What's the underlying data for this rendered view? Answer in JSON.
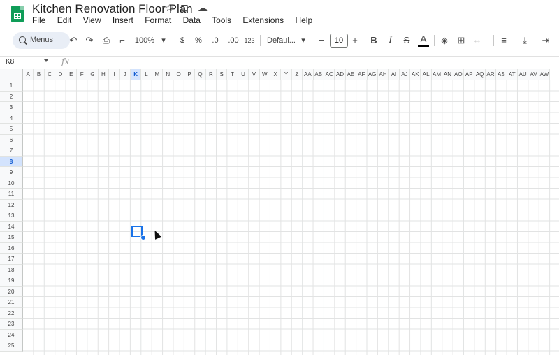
{
  "doc": {
    "title": "Kitchen Renovation Floor Plan"
  },
  "menu": [
    "File",
    "Edit",
    "View",
    "Insert",
    "Format",
    "Data",
    "Tools",
    "Extensions",
    "Help"
  ],
  "toolbar": {
    "search_label": "Menus",
    "zoom": "100%",
    "currency": "$",
    "percent": "%",
    "dec_decrease": ".0",
    "dec_increase": ".00",
    "number_format": "123",
    "font": "Defaul...",
    "font_size": "10"
  },
  "formula": {
    "cell_ref": "K8",
    "fx": "fx",
    "value": ""
  },
  "grid": {
    "columns": [
      "A",
      "B",
      "C",
      "D",
      "E",
      "F",
      "G",
      "H",
      "I",
      "J",
      "K",
      "L",
      "M",
      "N",
      "O",
      "P",
      "Q",
      "R",
      "S",
      "T",
      "U",
      "V",
      "W",
      "X",
      "Y",
      "Z",
      "AA",
      "AB",
      "AC",
      "AD",
      "AE",
      "AF",
      "AG",
      "AH",
      "AI",
      "AJ",
      "AK",
      "AL",
      "AM",
      "AN",
      "AO",
      "AP",
      "AQ",
      "AR",
      "AS",
      "AT",
      "AU",
      "AV",
      "AW"
    ],
    "rows": [
      "1",
      "2",
      "3",
      "4",
      "5",
      "6",
      "7",
      "8",
      "9",
      "10",
      "11",
      "12",
      "13",
      "14",
      "15",
      "16",
      "17",
      "18",
      "19",
      "20",
      "21",
      "22",
      "23",
      "24",
      "25"
    ],
    "selected_column": "K",
    "selected_row": "8"
  },
  "colors": {
    "accent": "#1a73e8",
    "header_bg": "#f8f9fa",
    "selected_header": "#d3e3fd",
    "sheets_green": "#0f9d58"
  },
  "icons": [
    "star-icon",
    "move-folder-icon",
    "cloud-icon",
    "undo-icon",
    "redo-icon",
    "print-icon",
    "paint-format-icon",
    "bold-icon",
    "italic-icon",
    "strikethrough-icon",
    "text-color-icon",
    "fill-color-icon",
    "borders-icon",
    "merge-icon",
    "align-icon",
    "valign-icon",
    "text-rotate-icon"
  ]
}
